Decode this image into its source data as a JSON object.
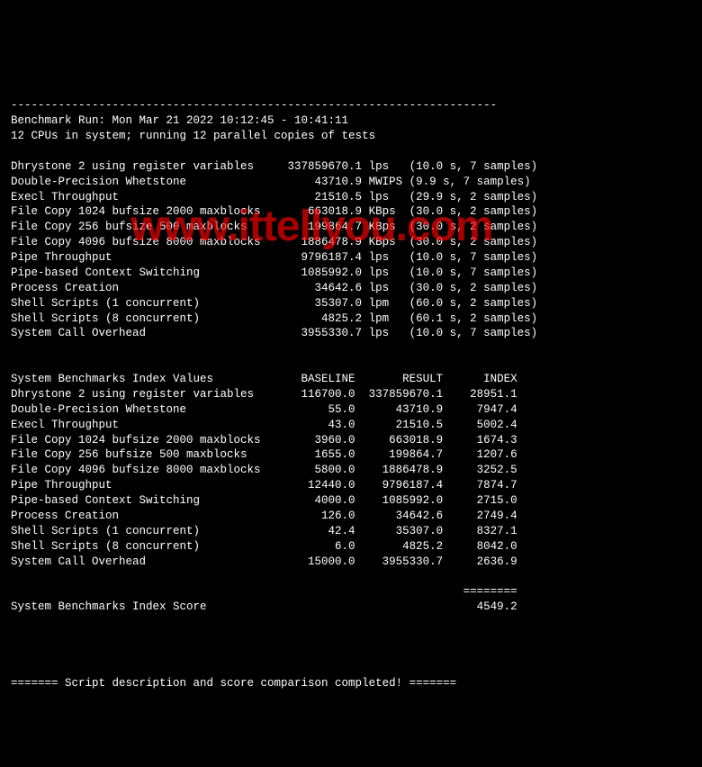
{
  "watermark": "www.ittellyou.com",
  "header": {
    "separator_top": "------------------------------------------------------------------------",
    "run_line": "Benchmark Run: Mon Mar 21 2022 10:12:45 - 10:41:11",
    "cpu_line": "12 CPUs in system; running 12 parallel copies of tests"
  },
  "results": [
    {
      "name": "Dhrystone 2 using register variables",
      "value": "337859670.1",
      "unit": "lps",
      "timing": "(10.0 s, 7 samples)"
    },
    {
      "name": "Double-Precision Whetstone",
      "value": "43710.9",
      "unit": "MWIPS",
      "timing": "(9.9 s, 7 samples)"
    },
    {
      "name": "Execl Throughput",
      "value": "21510.5",
      "unit": "lps",
      "timing": "(29.9 s, 2 samples)"
    },
    {
      "name": "File Copy 1024 bufsize 2000 maxblocks",
      "value": "663018.9",
      "unit": "KBps",
      "timing": "(30.0 s, 2 samples)"
    },
    {
      "name": "File Copy 256 bufsize 500 maxblocks",
      "value": "199864.7",
      "unit": "KBps",
      "timing": "(30.0 s, 2 samples)"
    },
    {
      "name": "File Copy 4096 bufsize 8000 maxblocks",
      "value": "1886478.9",
      "unit": "KBps",
      "timing": "(30.0 s, 2 samples)"
    },
    {
      "name": "Pipe Throughput",
      "value": "9796187.4",
      "unit": "lps",
      "timing": "(10.0 s, 7 samples)"
    },
    {
      "name": "Pipe-based Context Switching",
      "value": "1085992.0",
      "unit": "lps",
      "timing": "(10.0 s, 7 samples)"
    },
    {
      "name": "Process Creation",
      "value": "34642.6",
      "unit": "lps",
      "timing": "(30.0 s, 2 samples)"
    },
    {
      "name": "Shell Scripts (1 concurrent)",
      "value": "35307.0",
      "unit": "lpm",
      "timing": "(60.0 s, 2 samples)"
    },
    {
      "name": "Shell Scripts (8 concurrent)",
      "value": "4825.2",
      "unit": "lpm",
      "timing": "(60.1 s, 2 samples)"
    },
    {
      "name": "System Call Overhead",
      "value": "3955330.7",
      "unit": "lps",
      "timing": "(10.0 s, 7 samples)"
    }
  ],
  "index_header": {
    "title": "System Benchmarks Index Values",
    "col_baseline": "BASELINE",
    "col_result": "RESULT",
    "col_index": "INDEX"
  },
  "indexes": [
    {
      "name": "Dhrystone 2 using register variables",
      "baseline": "116700.0",
      "result": "337859670.1",
      "index": "28951.1"
    },
    {
      "name": "Double-Precision Whetstone",
      "baseline": "55.0",
      "result": "43710.9",
      "index": "7947.4"
    },
    {
      "name": "Execl Throughput",
      "baseline": "43.0",
      "result": "21510.5",
      "index": "5002.4"
    },
    {
      "name": "File Copy 1024 bufsize 2000 maxblocks",
      "baseline": "3960.0",
      "result": "663018.9",
      "index": "1674.3"
    },
    {
      "name": "File Copy 256 bufsize 500 maxblocks",
      "baseline": "1655.0",
      "result": "199864.7",
      "index": "1207.6"
    },
    {
      "name": "File Copy 4096 bufsize 8000 maxblocks",
      "baseline": "5800.0",
      "result": "1886478.9",
      "index": "3252.5"
    },
    {
      "name": "Pipe Throughput",
      "baseline": "12440.0",
      "result": "9796187.4",
      "index": "7874.7"
    },
    {
      "name": "Pipe-based Context Switching",
      "baseline": "4000.0",
      "result": "1085992.0",
      "index": "2715.0"
    },
    {
      "name": "Process Creation",
      "baseline": "126.0",
      "result": "34642.6",
      "index": "2749.4"
    },
    {
      "name": "Shell Scripts (1 concurrent)",
      "baseline": "42.4",
      "result": "35307.0",
      "index": "8327.1"
    },
    {
      "name": "Shell Scripts (8 concurrent)",
      "baseline": "6.0",
      "result": "4825.2",
      "index": "8042.0"
    },
    {
      "name": "System Call Overhead",
      "baseline": "15000.0",
      "result": "3955330.7",
      "index": "2636.9"
    }
  ],
  "score": {
    "separator": "                                                                   ========",
    "label": "System Benchmarks Index Score",
    "value": "4549.2"
  },
  "footer": {
    "line": "======= Script description and score comparison completed! ======="
  }
}
